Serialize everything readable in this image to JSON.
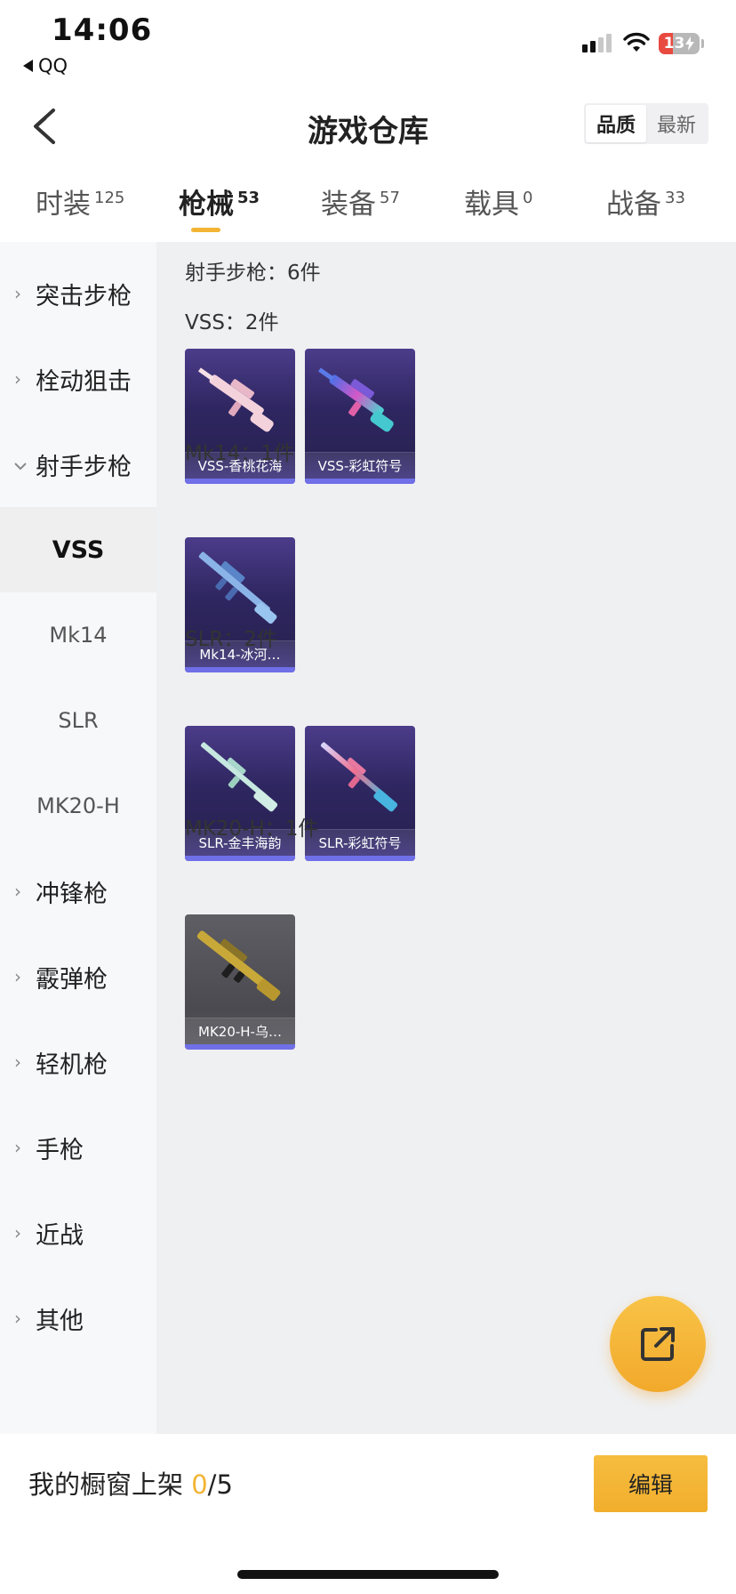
{
  "status_bar": {
    "time": "14:06",
    "back_app": "QQ",
    "battery": "13",
    "battery_level": 0.13
  },
  "header": {
    "title": "游戏仓库",
    "sort_options": [
      "品质",
      "最新"
    ],
    "sort_selected": "品质"
  },
  "tabs": [
    {
      "label": "时装",
      "count": "125"
    },
    {
      "label": "枪械",
      "count": "53"
    },
    {
      "label": "装备",
      "count": "57"
    },
    {
      "label": "载具",
      "count": "0"
    },
    {
      "label": "战备",
      "count": "33"
    }
  ],
  "sidebar": {
    "items": [
      {
        "label": "突击步枪"
      },
      {
        "label": "栓动狙击"
      },
      {
        "label": "射手步枪"
      },
      {
        "label": "VSS"
      },
      {
        "label": "Mk14"
      },
      {
        "label": "SLR"
      },
      {
        "label": "MK20-H"
      },
      {
        "label": "冲锋枪"
      },
      {
        "label": "霰弹枪"
      },
      {
        "label": "轻机枪"
      },
      {
        "label": "手枪"
      },
      {
        "label": "近战"
      },
      {
        "label": "其他"
      }
    ]
  },
  "content": {
    "category_header": "射手步枪：6件",
    "groups": [
      {
        "label": "VSS：2件",
        "items": [
          {
            "name": "VSS-香桃花海"
          },
          {
            "name": "VSS-彩虹符号"
          }
        ]
      },
      {
        "label": "Mk14：1件",
        "items": [
          {
            "name": "Mk14-冰河…"
          }
        ]
      },
      {
        "label": "SLR：2件",
        "items": [
          {
            "name": "SLR-金丰海韵"
          },
          {
            "name": "SLR-彩虹符号"
          }
        ]
      },
      {
        "label": "MK20-H：1件",
        "items": [
          {
            "name": "MK20-H-乌…"
          }
        ]
      }
    ]
  },
  "bottom": {
    "showcase_prefix": "我的橱窗上架 ",
    "showcase_count": "0",
    "showcase_total": "/5",
    "edit_label": "编辑"
  },
  "colors": {
    "accent": "#f3b434",
    "card_purple": "#2e2660",
    "card_bar": "#6f6fe8"
  },
  "icons": [
    "back-arrow-icon",
    "signal-icon",
    "wifi-icon",
    "battery-icon",
    "chevron-right-icon",
    "chevron-down-icon",
    "share-external-icon"
  ]
}
